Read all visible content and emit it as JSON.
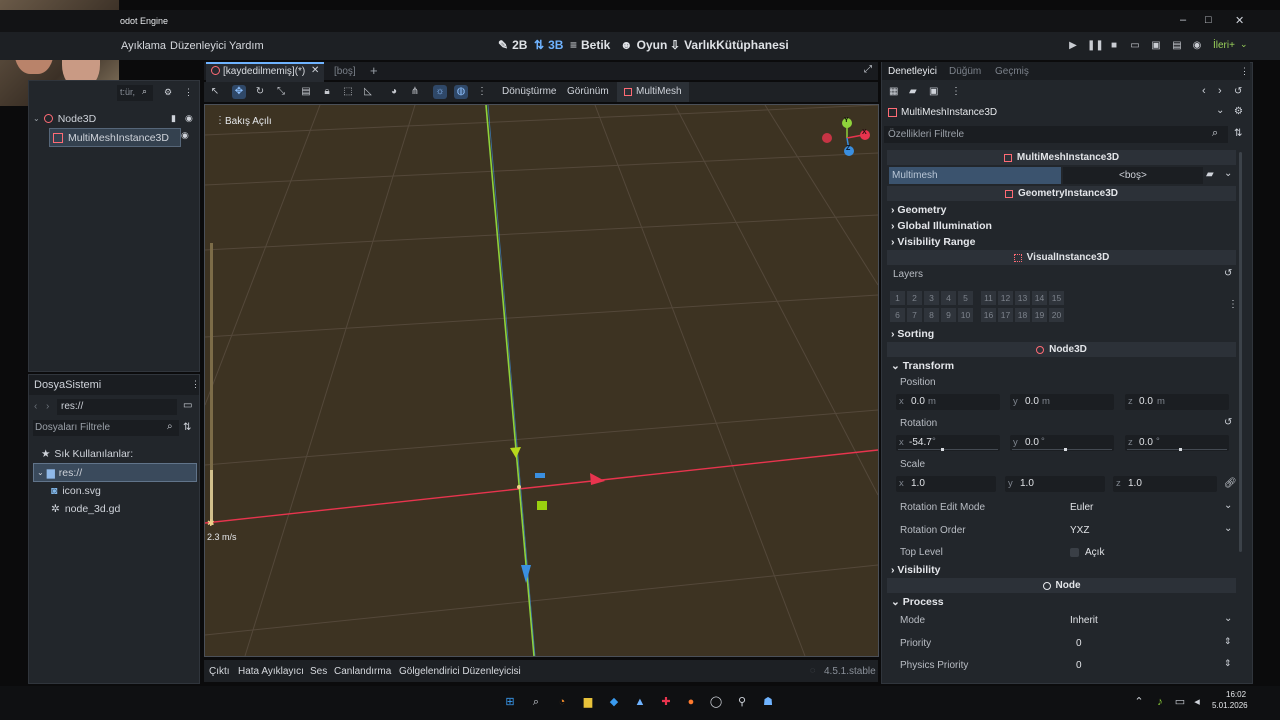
{
  "window": {
    "title": "odot Engine",
    "controls": {
      "minimize": "–",
      "maximize": "□",
      "close": "✕"
    }
  },
  "menu": {
    "items": [
      "Ayıklama",
      "Düzenleyici",
      "Yardım"
    ]
  },
  "workspaces": [
    {
      "label": "2B",
      "icon": "2d-icon"
    },
    {
      "label": "3B",
      "icon": "3d-icon",
      "active": true
    },
    {
      "label": "Betik",
      "icon": "script-icon"
    },
    {
      "label": "Oyun",
      "icon": "game-icon"
    },
    {
      "label": "VarlıkKütüphanesi",
      "icon": "asset-library-icon"
    }
  ],
  "renderer": {
    "label": "İleri+"
  },
  "scene_dock": {
    "filter_placeholder": "t:ür,",
    "tree": [
      {
        "label": "Node3D",
        "icon": "node3d-icon"
      },
      {
        "label": "MultiMeshInstance3D",
        "icon": "multimesh-icon",
        "selected": true
      }
    ]
  },
  "filesystem": {
    "tab": "DosyaSistemi",
    "path": "res://",
    "filter_placeholder": "Dosyaları Filtrele",
    "favorites_label": "Sık Kullanılanlar:",
    "items": [
      {
        "label": "res://",
        "icon": "folder-icon",
        "selected": true
      },
      {
        "label": "icon.svg",
        "icon": "svg-file-icon"
      },
      {
        "label": "node_3d.gd",
        "icon": "gear-icon"
      }
    ]
  },
  "editor_tabs": [
    {
      "label": "[kaydedilmemiş](*)",
      "active": true
    },
    {
      "label": "[boş]",
      "active": false
    }
  ],
  "viewport_menu": {
    "transform": "Dönüştürme",
    "view": "Görünüm",
    "multimesh": "MultiMesh"
  },
  "viewport": {
    "perspective_label": "Bakış Açılı",
    "speed_label": "2.3 m/s",
    "gizmo_axes": [
      "Y",
      "X",
      "Z"
    ]
  },
  "bottom_panel": {
    "tabs": [
      "Çıktı",
      "Hata Ayıklayıcı",
      "Ses",
      "Canlandırma",
      "Gölgelendirici Düzenleyicisi"
    ],
    "version": "4.5.1.stable"
  },
  "inspector": {
    "tabs": [
      "Denetleyici",
      "Düğüm",
      "Geçmiş"
    ],
    "node_name": "MultiMeshInstance3D",
    "filter_placeholder": "Özellikleri Filtrele",
    "sections": {
      "multimesh": "MultiMeshInstance3D",
      "geometry_instance": "GeometryInstance3D",
      "visual_instance": "VisualInstance3D",
      "node3d": "Node3D",
      "node": "Node"
    },
    "multimesh_prop": {
      "label": "Multimesh",
      "value": "<boş>"
    },
    "groups": {
      "geometry": "Geometry",
      "gi": "Global Illumination",
      "visibility_range": "Visibility Range",
      "sorting": "Sorting",
      "transform": "Transform",
      "visibility": "Visibility",
      "process": "Process"
    },
    "layers_label": "Layers",
    "layers_row1": [
      "1",
      "2",
      "3",
      "4",
      "5",
      "11",
      "12",
      "13",
      "14",
      "15"
    ],
    "layers_row2": [
      "6",
      "7",
      "8",
      "9",
      "10",
      "16",
      "17",
      "18",
      "19",
      "20"
    ],
    "position": {
      "label": "Position",
      "x": "0.0",
      "y": "0.0",
      "z": "0.0",
      "unit": "m"
    },
    "rotation": {
      "label": "Rotation",
      "x": "-54.7",
      "y": "0.0",
      "z": "0.0",
      "unit": "°"
    },
    "scale": {
      "label": "Scale",
      "x": "1.0",
      "y": "1.0",
      "z": "1.0"
    },
    "rotation_edit_mode": {
      "label": "Rotation Edit Mode",
      "value": "Euler"
    },
    "rotation_order": {
      "label": "Rotation Order",
      "value": "YXZ"
    },
    "top_level": {
      "label": "Top Level",
      "value": "Açık"
    },
    "mode": {
      "label": "Mode",
      "value": "Inherit"
    },
    "priority": {
      "label": "Priority",
      "value": "0"
    },
    "physics_priority": {
      "label": "Physics Priority",
      "value": "0"
    }
  },
  "taskbar": {
    "time": "16:02",
    "date": "5.01.2026"
  },
  "colors": {
    "accent": "#6fb3ff",
    "x_axis": "#e8344e",
    "y_axis": "#8fd33b",
    "z_axis": "#3a8fe0",
    "viewport_bg": "#3d3322"
  }
}
